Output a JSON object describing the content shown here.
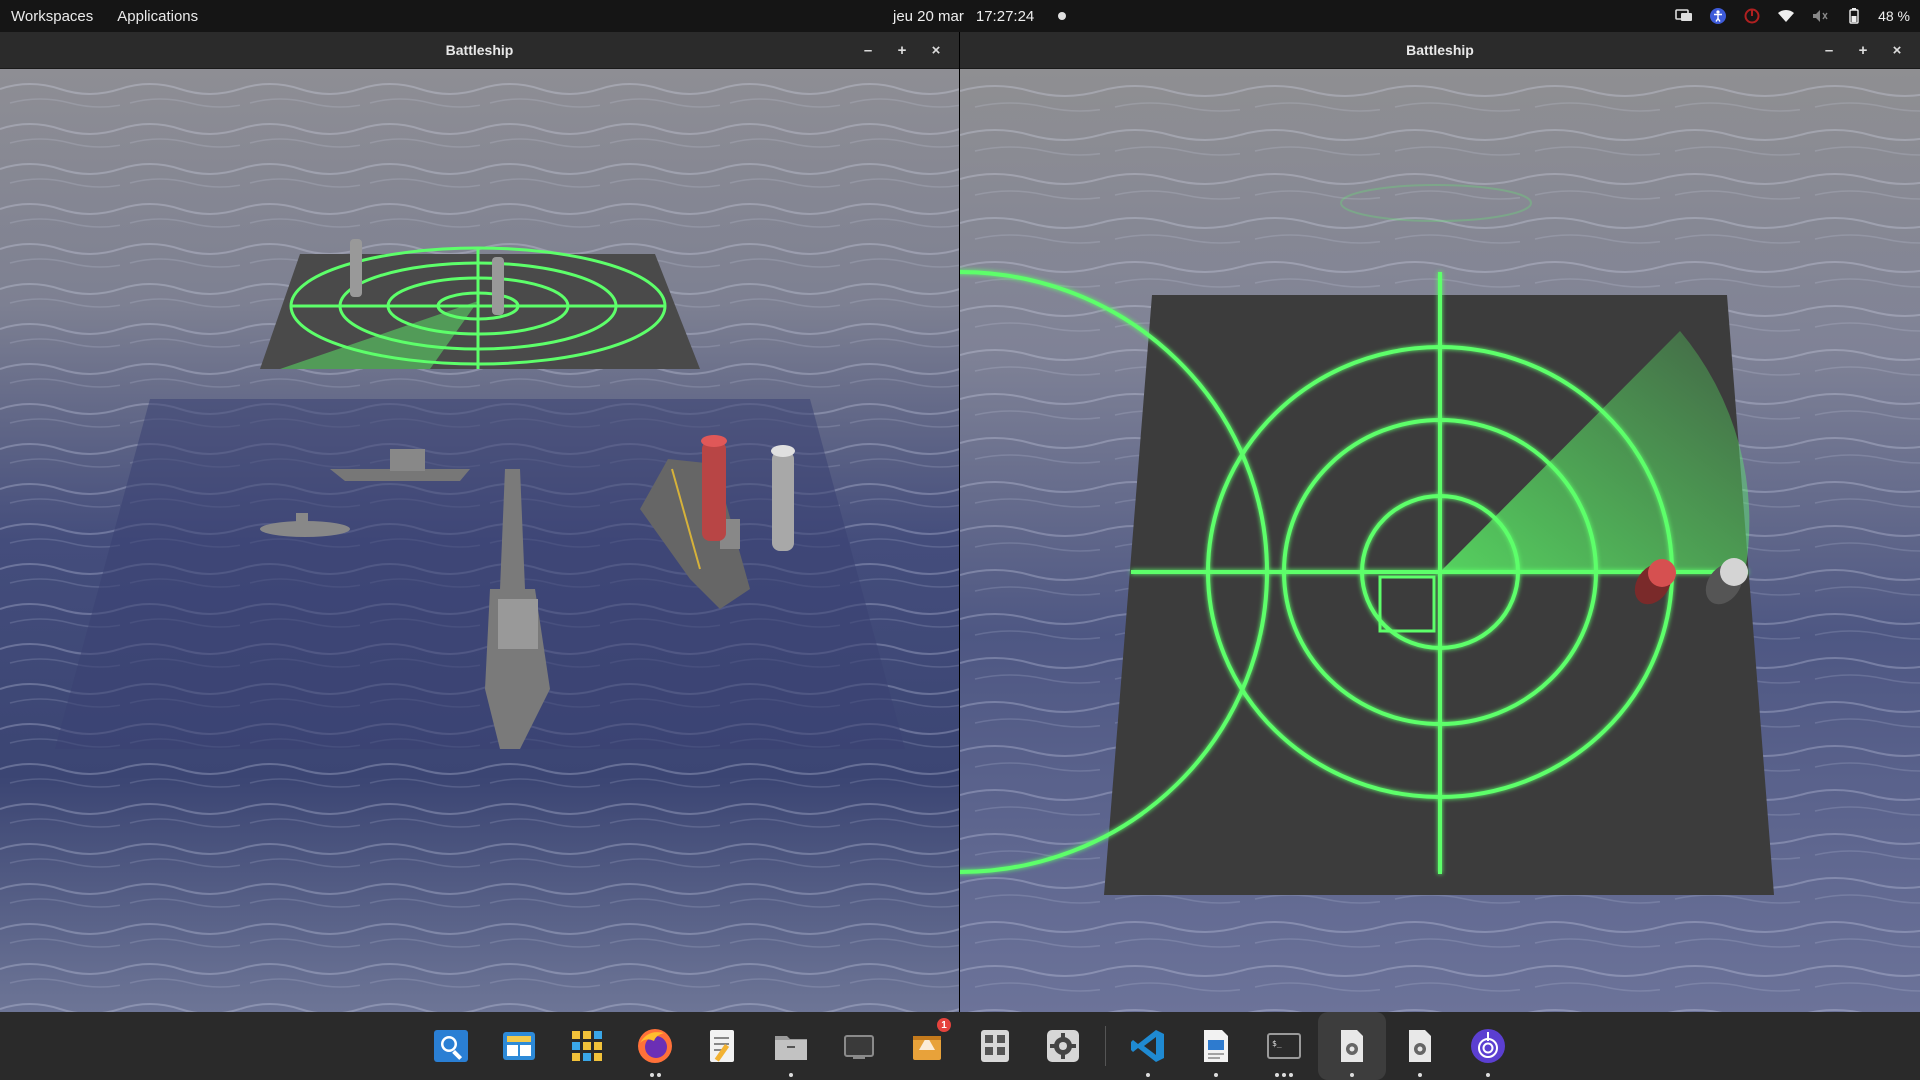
{
  "topbar": {
    "workspaces": "Workspaces",
    "applications": "Applications",
    "date": "jeu 20 mar",
    "time": "17:27:24",
    "battery": "48 %"
  },
  "windows": {
    "left": {
      "title": "Battleship"
    },
    "right": {
      "title": "Battleship"
    }
  },
  "window_buttons": {
    "minimize": "–",
    "maximize": "+",
    "close": "×"
  },
  "dock": {
    "notification_badge": "1"
  },
  "colors": {
    "radar_green": "#5dff6a",
    "sea": "#3b4570",
    "topbar": "#151515",
    "dock": "#2a2a2a"
  }
}
